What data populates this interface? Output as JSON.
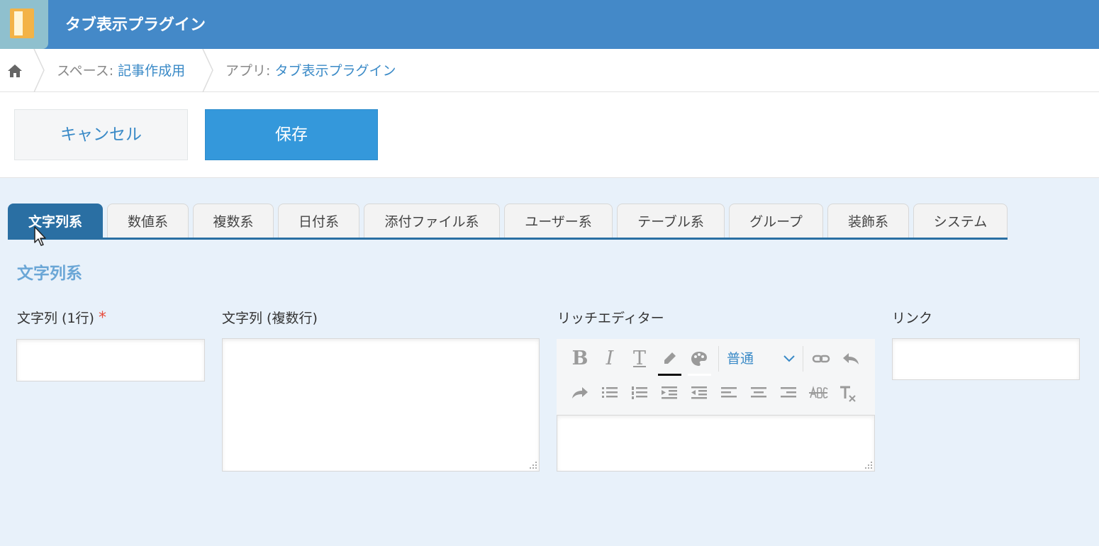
{
  "app": {
    "title": "タブ表示プラグイン"
  },
  "breadcrumb": {
    "space_prefix": "スペース: ",
    "space_name": "記事作成用",
    "app_prefix": "アプリ: ",
    "app_name": "タブ表示プラグイン"
  },
  "actions": {
    "cancel_label": "キャンセル",
    "save_label": "保存"
  },
  "tabs": [
    {
      "label": "文字列系",
      "active": true
    },
    {
      "label": "数値系"
    },
    {
      "label": "複数系"
    },
    {
      "label": "日付系"
    },
    {
      "label": "添付ファイル系"
    },
    {
      "label": "ユーザー系"
    },
    {
      "label": "テーブル系"
    },
    {
      "label": "グループ"
    },
    {
      "label": "装飾系"
    },
    {
      "label": "システム"
    }
  ],
  "section": {
    "title": "文字列系"
  },
  "fields": {
    "single_line": {
      "label": "文字列 (1行)",
      "required_mark": "*",
      "value": ""
    },
    "multi_line": {
      "label": "文字列 (複数行)",
      "value": ""
    },
    "rich_editor": {
      "label": "リッチエディター",
      "font_size_value": "普通",
      "tools_row1": [
        "bold-icon",
        "italic-icon",
        "text-size-icon",
        "font-color-icon",
        "background-color-icon",
        "font-size-select",
        "link-icon",
        "undo-icon"
      ],
      "tools_row2": [
        "redo-icon",
        "bulleted-list-icon",
        "numbered-list-icon",
        "indent-icon",
        "outdent-icon",
        "align-left-icon",
        "align-center-icon",
        "align-right-icon",
        "strikethrough-icon",
        "clear-format-icon"
      ]
    },
    "link": {
      "label": "リンク",
      "value": ""
    }
  },
  "colors": {
    "header": "#4489c8",
    "accent": "#3498db",
    "active_tab": "#2a6fa3",
    "background": "#e8f1fa"
  }
}
